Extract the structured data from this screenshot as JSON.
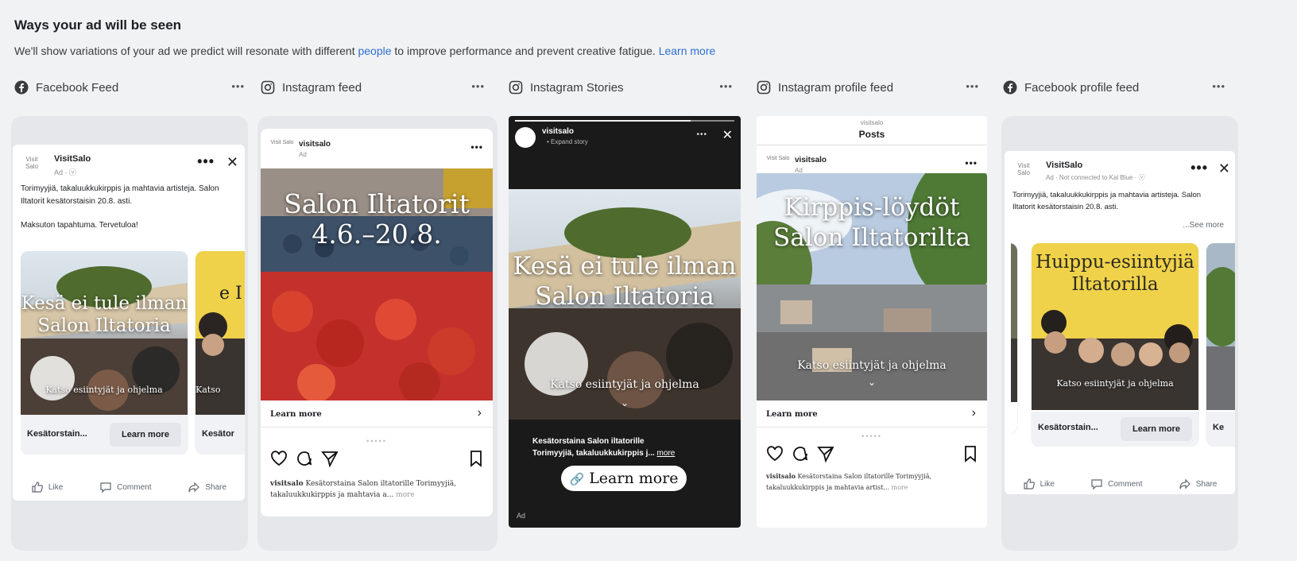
{
  "header": {
    "title": "Ways your ad will be seen",
    "desc_before": "We'll show variations of your ad we predict will resonate with different ",
    "desc_link1": "people",
    "desc_after": " to improve performance and prevent creative fatigue. ",
    "desc_link2": "Learn more"
  },
  "placements": [
    {
      "label": "Facebook Feed",
      "icon": "facebook-icon",
      "more": "•••"
    },
    {
      "label": "Instagram feed",
      "icon": "instagram-icon",
      "more": "•••"
    },
    {
      "label": "Instagram Stories",
      "icon": "instagram-icon",
      "more": "•••"
    },
    {
      "label": "Instagram profile feed",
      "icon": "instagram-icon",
      "more": "•••"
    },
    {
      "label": "Facebook profile feed",
      "icon": "facebook-icon",
      "more": "•••"
    }
  ],
  "fb_feed": {
    "logo": "Visit Salo",
    "name": "VisitSalo",
    "sub": "Ad · ⓥ",
    "more": "•••",
    "close": "✕",
    "text1": "Torimyyjiä, takaluukkukirppis ja mahtavia artisteja. Salon Iltatorit kesätorstaisin 20.8. asti.",
    "text2": "Maksuton tapahtuma. Tervetuloa!",
    "card1_overlay": "Kesä ei tule ilman Salon Iltatoria",
    "card1_cta": "Katso esiintyjät ja ohjelma",
    "card1_footer": "Kesätorstain...",
    "card1_button": "Learn more",
    "card2_overlay": "e I",
    "card2_cta": "Katso",
    "card2_footer": "Kesätor",
    "like": "Like",
    "comment": "Comment",
    "share": "Share"
  },
  "ig_feed": {
    "logo": "Visit Salo",
    "name": "visitsalo",
    "sub": "Ad",
    "more": "•••",
    "overlay": "Salon Iltatorit 4.6.–20.8.",
    "learn": "Learn more",
    "chevron": "›",
    "dots": "•••••",
    "cap_name": "visitsalo",
    "cap_text": " Kesätorstaina Salon iltatorille Torimyyjiä, takaluukkukirppis ja mahtavia a...",
    "cap_more": " more"
  },
  "ig_stories": {
    "name": "visitsalo",
    "sub": "• Expand story",
    "more": "•••",
    "close": "✕",
    "overlay": "Kesä ei tule ilman Salon Iltatoria",
    "cta": "Katso esiintyjät ja ohjelma",
    "cap1": "Kesätorstaina Salon iltatorille",
    "cap2": "Torimyyjiä, takaluukkukirppis j...",
    "cap_more": "more",
    "button": "Learn more",
    "ad_label": "Ad"
  },
  "ig_profile": {
    "top_small": "visitsalo",
    "top_title": "Posts",
    "logo": "Visit Salo",
    "name": "visitsalo",
    "sub": "Ad",
    "more": "•••",
    "overlay": "Kirppis-löydöt Salon Iltatorilta",
    "cta": "Katso esiintyjät ja ohjelma",
    "learn": "Learn more",
    "chevron": "›",
    "dots": "•••••",
    "cap_name": "visitsalo",
    "cap_text": " Kesätorstaina Salon iltatorille Torimyyjiä, takaluukkukirppis ja mahtavia artist...",
    "cap_more": " more"
  },
  "fb_profile": {
    "logo": "Visit Salo",
    "name": "VisitSalo",
    "sub": "Ad · Not connected to Kal Blue · ⓥ",
    "more": "•••",
    "close": "✕",
    "text": "Torimyyjiä, takaluukkukirppis ja mahtavia artisteja. Salon Iltatorit kesätorstaisin 20.8. asti.",
    "see_more": "...See more",
    "overlay": "Huippu-esiintyjiä Iltatorilla",
    "cta": "Katso esiintyjät ja ohjelma",
    "footer": "Kesätorstain...",
    "button": "Learn more",
    "next_footer": "Ke",
    "like": "Like",
    "comment": "Comment",
    "share": "Share"
  },
  "colors": {
    "link": "#2f6fd1",
    "yellow": "#efd24a"
  }
}
